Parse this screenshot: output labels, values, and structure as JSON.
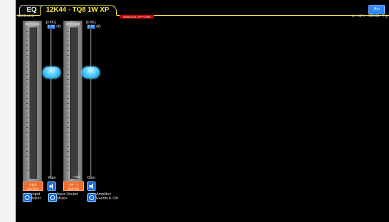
{
  "tabs": {
    "eq_label": "EQ",
    "active_label": "12K44 - TQ8 1W XP"
  },
  "header": {
    "module_label": "MODULE",
    "status_text": "MODULE OFFLINE",
    "path_text": "A - XP1 - 12K44 - TQ",
    "right_button_label": "Pro"
  },
  "channels": [
    {
      "meter_foot": "",
      "readout": "[0.00]",
      "gain_value": "0.00",
      "unit": "dB",
      "gain_label": "Gain",
      "mute_line1": "Input",
      "mute_line2": "MUTED",
      "link_line1": "Input",
      "link_line2": "Mixer"
    },
    {
      "meter_foot": "Fdbk",
      "readout": "[0.00]",
      "gain_value": "0.00",
      "unit": "dB",
      "gain_label": "Gain",
      "mute_line1": "XR - 1",
      "mute_line2": "MUTED",
      "link_line1": "Input Router",
      "link_line2": "Mutes"
    }
  ],
  "amp_link": {
    "line1": "Amplifier",
    "line2": "Events & Ctrl"
  },
  "colors": {
    "accent_tab": "#f7e04a",
    "mute": "#f26d2b",
    "knob": "#40c4ff",
    "status_red": "#cc0000"
  }
}
